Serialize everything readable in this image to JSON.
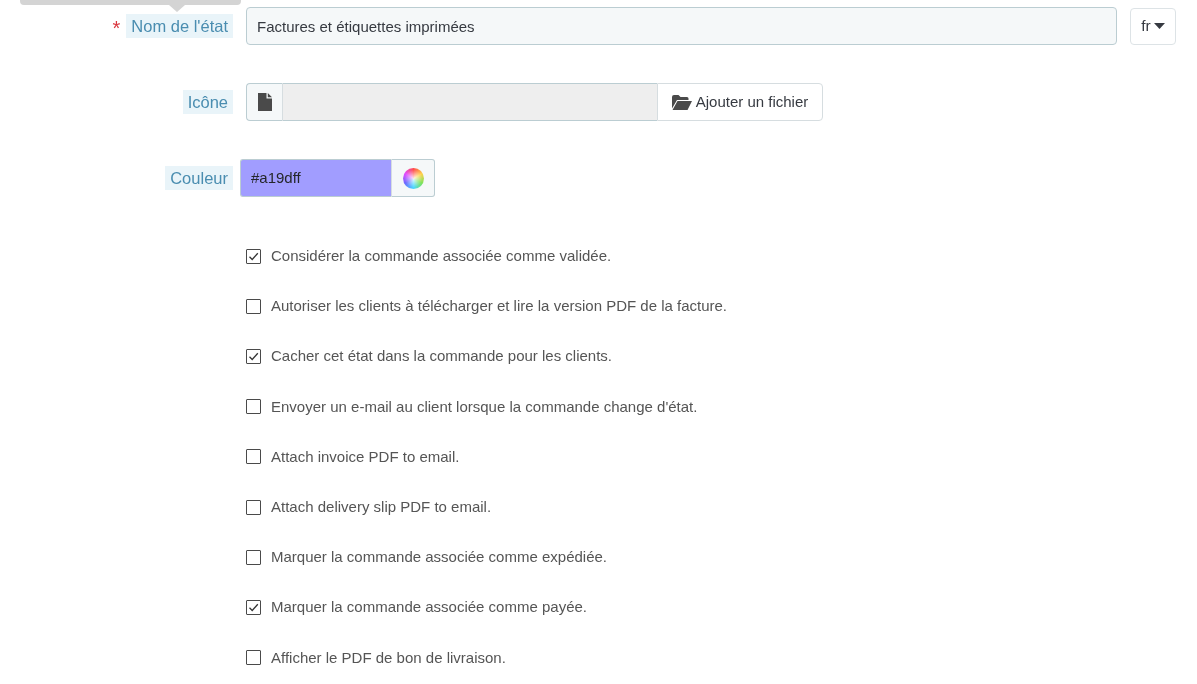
{
  "state_name": {
    "required_mark": "*",
    "label": "Nom de l'état",
    "value": "Factures et étiquettes imprimées",
    "language": "fr"
  },
  "icon": {
    "label": "Icône",
    "button": "Ajouter un fichier"
  },
  "color": {
    "label": "Couleur",
    "value": "#a19dff"
  },
  "options": [
    {
      "label": "Considérer la commande associée comme validée.",
      "checked": true
    },
    {
      "label": "Autoriser les clients à télécharger et lire la version PDF de la facture.",
      "checked": false
    },
    {
      "label": "Cacher cet état dans la commande pour les clients.",
      "checked": true
    },
    {
      "label": "Envoyer un e-mail au client lorsque la commande change d'état.",
      "checked": false
    },
    {
      "label": "Attach invoice PDF to email.",
      "checked": false
    },
    {
      "label": "Attach delivery slip PDF to email.",
      "checked": false
    },
    {
      "label": "Marquer la commande associée comme expédiée.",
      "checked": false
    },
    {
      "label": "Marquer la commande associée comme payée.",
      "checked": true
    },
    {
      "label": "Afficher le PDF de bon de livraison.",
      "checked": false
    }
  ]
}
